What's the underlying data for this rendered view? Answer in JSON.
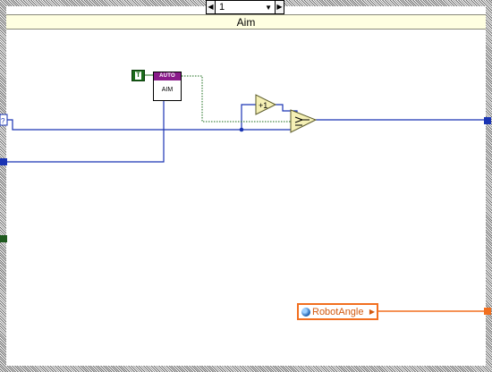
{
  "case_selector": {
    "value": "1",
    "decrement_glyph": "◀",
    "increment_glyph": "▶",
    "dropdown_glyph": "▼"
  },
  "case_title": "Aim",
  "constants": {
    "boolean_true": "T"
  },
  "subvi": {
    "header": "AUTO",
    "label": "AIM",
    "header_color": "#8a1b8a"
  },
  "increment_node": {
    "label": "+1"
  },
  "global_variable": {
    "name": "RobotAngle",
    "icon": "globe-icon",
    "arrow": "▶",
    "color": "#f26f1f"
  },
  "colors": {
    "numeric_wire": "#1a34b3",
    "boolean_wire": "#1a6b1a",
    "dbl_wire": "#f26f1f",
    "primitive_fill": "#f5f0b5",
    "tunnel_boolean": "#1f5a1f"
  }
}
